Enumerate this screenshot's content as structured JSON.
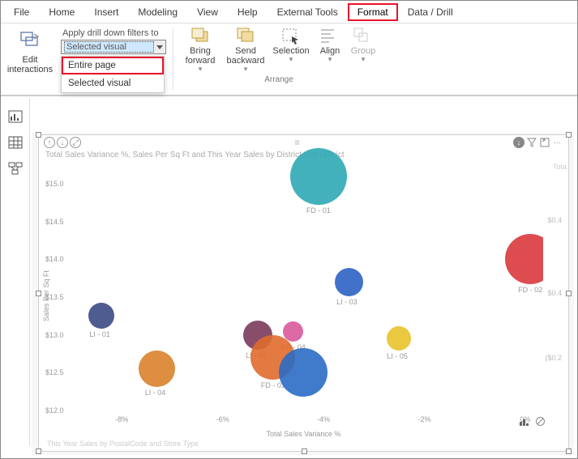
{
  "ribbon": {
    "tabs": [
      "File",
      "Home",
      "Insert",
      "Modeling",
      "View",
      "Help",
      "External Tools",
      "Format",
      "Data / Drill"
    ],
    "active_tab": "Format"
  },
  "interactions": {
    "button_label": "Edit interactions",
    "drill_label": "Apply drill down filters to",
    "drill_selected": "Selected visual",
    "dropdown": {
      "opt1": "Entire page",
      "opt2": "Selected visual"
    }
  },
  "arrange": {
    "group_label": "Arrange",
    "bring_forward": "Bring forward",
    "send_backward": "Send backward",
    "selection": "Selection",
    "align": "Align",
    "group": "Group"
  },
  "chart_data": {
    "type": "scatter",
    "title": "Total Sales Variance %, Sales Per Sq Ft and This Year Sales by District and District",
    "xlabel": "Total Sales Variance %",
    "ylabel": "Sales Per Sq Ft",
    "subtitle_right": "Tota",
    "y_ticks": [
      "$15.0",
      "$14.5",
      "$14.0",
      "$13.5",
      "$13.0",
      "$12.5",
      "$12.0"
    ],
    "x_ticks": [
      "-8%",
      "-6%",
      "-4%",
      "-2%",
      "0%"
    ],
    "right_ticks": [
      "$0.4",
      "$0.4",
      "($0.2"
    ],
    "footer_left": "This Year Sales by PostalCode and Store Type",
    "series": [
      {
        "name": "FD - 01",
        "x": -4.1,
        "y": 15.1,
        "size": 70,
        "color": "#2fa8b5"
      },
      {
        "name": "LI - 03",
        "x": -3.5,
        "y": 13.7,
        "size": 35,
        "color": "#2d62c4"
      },
      {
        "name": "FD - 02",
        "x": 0.1,
        "y": 14.0,
        "size": 62,
        "color": "#d9383c"
      },
      {
        "name": "LI - 01",
        "x": -8.4,
        "y": 13.25,
        "size": 32,
        "color": "#3b4a83"
      },
      {
        "name": "LI - 02",
        "x": -5.3,
        "y": 13.0,
        "size": 36,
        "color": "#7a3a5b"
      },
      {
        "name": "FD - 04",
        "x": -4.6,
        "y": 13.05,
        "size": 25,
        "color": "#d85a9a"
      },
      {
        "name": "LI - 05",
        "x": -2.5,
        "y": 12.95,
        "size": 30,
        "color": "#e8c22a"
      },
      {
        "name": "LI - 04",
        "x": -7.3,
        "y": 12.55,
        "size": 45,
        "color": "#d9822b"
      },
      {
        "name": "FD - 03",
        "x": -5.0,
        "y": 12.7,
        "size": 55,
        "color": "#df6b2e"
      },
      {
        "name": "bigblue",
        "x": -4.4,
        "y": 12.5,
        "size": 60,
        "color": "#2b6cc4",
        "hide_label": true
      }
    ],
    "xlim": [
      -9,
      0.5
    ],
    "ylim": [
      12.0,
      15.3
    ]
  }
}
